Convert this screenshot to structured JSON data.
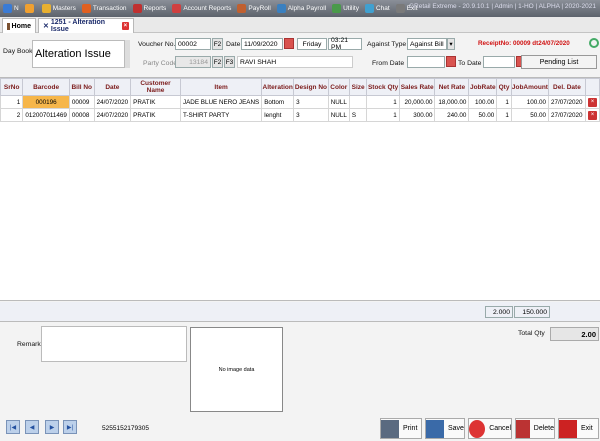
{
  "menubar": {
    "items": [
      {
        "label": "N",
        "icon": "app-icon",
        "color": "#3a7bd5"
      },
      {
        "label": "",
        "icon": "refresh-icon",
        "color": "#f0a030"
      },
      {
        "label": "Masters",
        "icon": "masters-icon",
        "color": "#e8b030"
      },
      {
        "label": "Transaction",
        "icon": "transaction-icon",
        "color": "#e06020"
      },
      {
        "label": "Reports",
        "icon": "reports-icon",
        "color": "#c03030"
      },
      {
        "label": "Account Reports",
        "icon": "account-reports-icon",
        "color": "#d04040"
      },
      {
        "label": "PayRoll",
        "icon": "payroll-icon",
        "color": "#c06030"
      },
      {
        "label": "Alpha Payroll",
        "icon": "alpha-payroll-icon",
        "color": "#3a80c0"
      },
      {
        "label": "Utility",
        "icon": "utility-icon",
        "color": "#4a9a4a"
      },
      {
        "label": "Chat",
        "icon": "chat-icon",
        "color": "#40a0d0"
      },
      {
        "label": "Exit",
        "icon": "exit-icon",
        "color": "#7a7a7a"
      }
    ],
    "title": "GRetail Extreme - 20.9.10.1 | Admin | 1-HO | ALPHA | 2020-2021"
  },
  "tabs": {
    "home": "Home",
    "active": "1251 - Alteration Issue"
  },
  "form": {
    "day_book_label": "Day Book",
    "day_book_value": "Alteration Issue",
    "voucher_label": "Voucher No.",
    "voucher_value": "00002",
    "f2": "F2",
    "f3": "F3",
    "date_label": "Date",
    "date_value": "11/09/2020",
    "day_value": "Friday",
    "time_value": "03:21 PM",
    "against_type_label": "Against Type",
    "against_type_value": "Against Bill",
    "receipt_info": "ReceiptNo: 00009 dt24/07/2020",
    "party_code_label": "Party Code",
    "party_code_value": "13184",
    "party_name": "RAVI SHAH",
    "from_date_label": "From Date",
    "to_date_label": "To Date",
    "pending_list": "Pending List"
  },
  "grid": {
    "columns": [
      "SrNo",
      "Barcode",
      "Bill No",
      "Date",
      "Customer Name",
      "Item",
      "Alteration",
      "Design No",
      "Color",
      "Size",
      "Stock Qty",
      "Sales Rate",
      "Net Rate",
      "JobRate",
      "Qty",
      "JobAmount",
      "Del. Date"
    ],
    "rows": [
      [
        "1",
        "000196",
        "00009",
        "24/07/2020",
        "PRATIK",
        "JADE BLUE NERO JEANS",
        "Bottom",
        "3",
        "NULL",
        "",
        "1",
        "20,000.00",
        "18,000.00",
        "100.00",
        "1",
        "100.00",
        "27/07/2020"
      ],
      [
        "2",
        "012007011469",
        "00008",
        "24/07/2020",
        "PRATIK",
        "T-SHIRT PARTY",
        "lenght",
        "3",
        "NULL",
        "S",
        "1",
        "300.00",
        "240.00",
        "50.00",
        "1",
        "50.00",
        "27/07/2020"
      ]
    ],
    "totals": {
      "qty": "2.000",
      "amount": "150.000"
    }
  },
  "footer": {
    "total_qty_label": "Total Qty",
    "total_qty_value": "2.00",
    "remarks_label": "Remarks",
    "no_image": "No image data",
    "record_code": "5255152179305",
    "buttons": {
      "print": "Print",
      "save": "Save",
      "cancel": "Cancel",
      "delete": "Delete",
      "exit": "Exit"
    }
  }
}
